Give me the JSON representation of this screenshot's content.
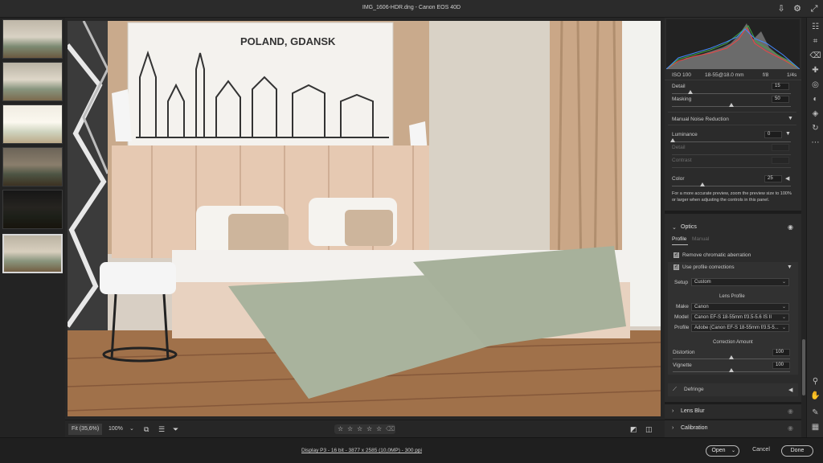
{
  "window": {
    "title": "IMG_1606-HDR.dng  -  Canon EOS 40D"
  },
  "photo": {
    "poster_text": "POLAND, GDANSK"
  },
  "camera_info": {
    "iso": "ISO 100",
    "lens": "18-55@18.0 mm",
    "aperture": "f/8",
    "shutter": "1/4s"
  },
  "detail": {
    "detail_label": "Detail",
    "detail_value": "15",
    "masking_label": "Masking",
    "masking_value": "50"
  },
  "manual_nr": {
    "heading": "Manual Noise Reduction",
    "luminance_label": "Luminance",
    "luminance_value": "0",
    "detail_label": "Detail",
    "contrast_label": "Contrast",
    "color_label": "Color",
    "color_value": "25",
    "note": "For a more accurate preview, zoom the preview size to 100% or larger when adjusting the controls in this panel."
  },
  "optics": {
    "heading": "Optics",
    "tab_profile": "Profile",
    "tab_manual": "Manual",
    "remove_ca": "Remove chromatic aberration",
    "use_profile": "Use profile corrections",
    "setup_label": "Setup",
    "setup_value": "Custom",
    "lens_profile_heading": "Lens Profile",
    "make_label": "Make",
    "make_value": "Canon",
    "model_label": "Model",
    "model_value": "Canon EF-S 18-55mm f/3.5-5.6 IS II",
    "profile_label": "Profile",
    "profile_value": "Adobe (Canon EF-S 18-55mm f/3.5-5...",
    "correction_heading": "Correction Amount",
    "distortion_label": "Distortion",
    "distortion_value": "100",
    "vignette_label": "Vignette",
    "vignette_value": "100"
  },
  "panels": {
    "defringe": "Defringe",
    "lens_blur": "Lens Blur",
    "calibration": "Calibration"
  },
  "bottombar": {
    "fit": "Fit (35,6%)",
    "zoom": "100%"
  },
  "statusbar": {
    "info": "Display P3 - 16 bit - 3877 x 2585 (10,0MP) - 300 ppi",
    "open": "Open",
    "cancel": "Cancel",
    "done": "Done"
  },
  "rating": {
    "stars": [
      "☆",
      "☆",
      "☆",
      "☆",
      "☆"
    ]
  }
}
